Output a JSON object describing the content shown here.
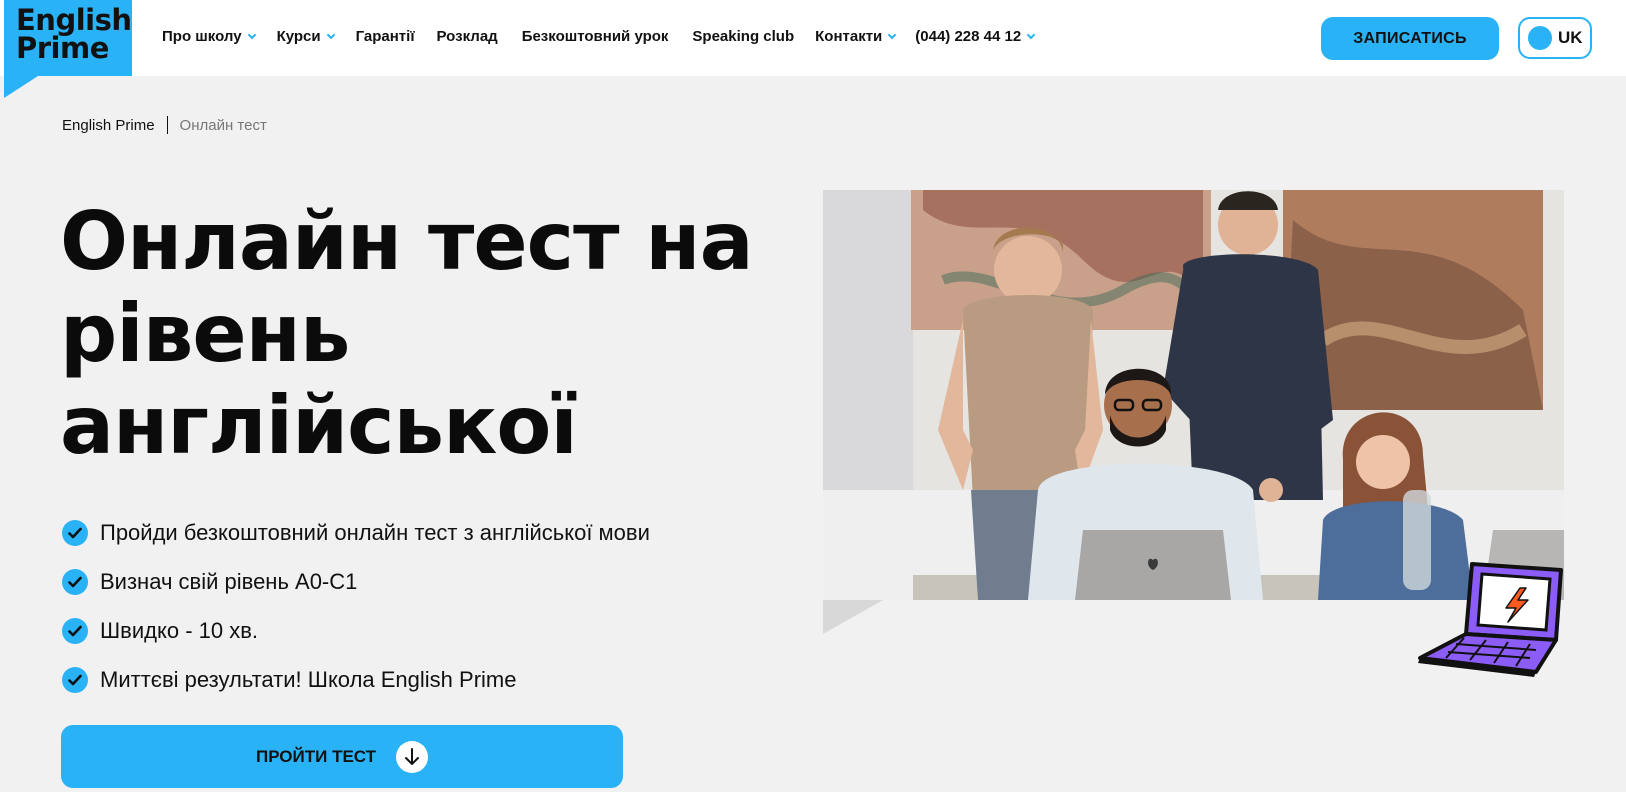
{
  "header": {
    "logo_line1": "English",
    "logo_line2": "Prime",
    "nav": [
      {
        "label": "Про школу",
        "dropdown": true
      },
      {
        "label": "Курси",
        "dropdown": true
      },
      {
        "label": "Гарантії",
        "dropdown": false
      },
      {
        "label": "Розклад",
        "dropdown": false
      },
      {
        "label": "Безкоштовний урок",
        "dropdown": false
      },
      {
        "label": "Speaking club",
        "dropdown": false
      },
      {
        "label": "Контакти",
        "dropdown": true
      },
      {
        "label": "(044) 228 44 12",
        "dropdown": true
      }
    ],
    "signup_label": "ЗАПИСАТИСЬ",
    "lang_label": "UK"
  },
  "breadcrumb": {
    "home": "English Prime",
    "current": "Онлайн тест"
  },
  "hero": {
    "title_line1": "Онлайн тест на",
    "title_line2": "рівень",
    "title_line3": "англійської",
    "features": [
      "Пройди безкоштовний онлайн тест з англійської мови",
      "Визнач свій рівень А0-С1",
      "Швидко - 10 хв.",
      "Миттєві результати! Школа English Prime"
    ],
    "cta_label": "ПРОЙТИ ТЕСТ"
  },
  "icons": {
    "check": "check-icon",
    "arrow": "arrow-down-icon",
    "laptop": "laptop-lightning-icon"
  },
  "colors": {
    "accent": "#29b2f5",
    "laptop_purple": "#8b5cf6",
    "bolt_orange": "#ff5a1f",
    "background": "#f1f1f1"
  }
}
